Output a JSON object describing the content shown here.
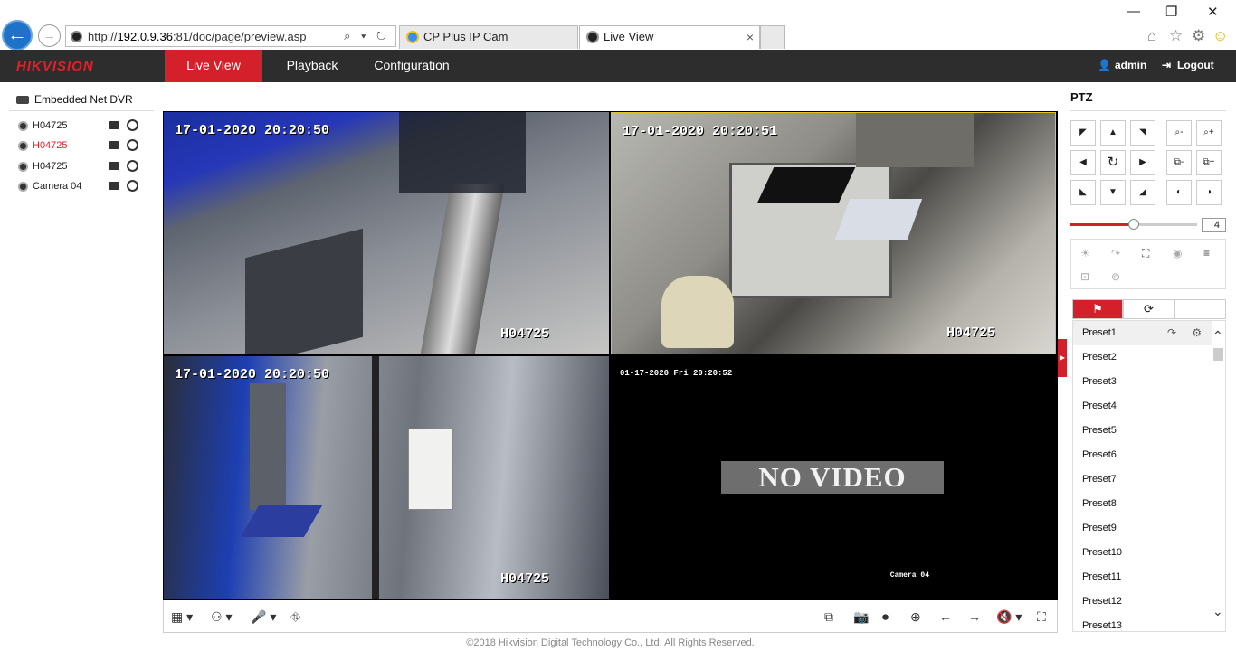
{
  "browser": {
    "url_prefix": "http://",
    "url_host": "192.0.9.36",
    "url_rest": ":81/doc/page/preview.asp",
    "url_tools": "⌕ ▾ ↻",
    "tabs": [
      {
        "label": "CP Plus IP Cam"
      },
      {
        "label": "Live View",
        "close": "×"
      }
    ],
    "win_controls": {
      "minimize": "—",
      "restore": "❐",
      "close": "✕"
    },
    "toolbar_icons": {
      "home": "⌂",
      "star": "☆",
      "gear": "⚙",
      "smiley": "☺"
    },
    "back_glyph": "←",
    "fwd_glyph": "→"
  },
  "header": {
    "logo": "HIKVISION",
    "nav": [
      {
        "label": "Live View",
        "active": true
      },
      {
        "label": "Playback",
        "active": false
      },
      {
        "label": "Configuration",
        "active": false
      }
    ],
    "user": "admin",
    "logout": "Logout",
    "user_glyph": "👤",
    "logout_glyph": "⇥"
  },
  "device_tree": {
    "root": "Embedded Net DVR",
    "channels": [
      {
        "label": "H04725",
        "color": "#111111"
      },
      {
        "label": "H04725",
        "color": "#e0202a"
      },
      {
        "label": "H04725",
        "color": "#111111"
      },
      {
        "label": "Camera 04",
        "color": "#111111"
      }
    ]
  },
  "video": {
    "panes": [
      {
        "timestamp": "17-01-2020 20:20:50",
        "name": "H04725"
      },
      {
        "timestamp": "17-01-2020 20:20:51",
        "name": "H04725"
      },
      {
        "timestamp": "17-01-2020 20:20:50",
        "name": "H04725"
      },
      {
        "timestamp": "01-17-2020 Fri 20:20:52",
        "name": "Camera 04",
        "message": "NO VIDEO"
      }
    ]
  },
  "toolbar": {
    "layout": "▦ ▾",
    "ptz": "⚇ ▾",
    "mic": "🎤 ▾",
    "record_all": "⛗",
    "right_icons": [
      "⧉",
      "📷",
      "⏺",
      "⊕",
      "←",
      "→",
      "🔇 ▾",
      "⛶"
    ]
  },
  "footer": "©2018 Hikvision Digital Technology Co., Ltd. All Rights Reserved.",
  "ptz": {
    "title": "PTZ",
    "dir_buttons": [
      "◤",
      "▲",
      "◥",
      "◀",
      "↻",
      "▶",
      "◣",
      "▼",
      "◢"
    ],
    "zoom_buttons": [
      "⌕-",
      "⌕+",
      "⧉-",
      "⧉+",
      "◐",
      "◑"
    ],
    "speed": 4,
    "speed_label": "4",
    "function_icons": [
      "☀",
      "↷",
      "⛶",
      "◉",
      "≡",
      "⊡",
      "⊚"
    ],
    "tabs": [
      {
        "label": "⚑",
        "active": true
      },
      {
        "label": "⟳",
        "active": false
      },
      {
        "label": "",
        "active": false
      }
    ],
    "presets": [
      "Preset1",
      "Preset2",
      "Preset3",
      "Preset4",
      "Preset5",
      "Preset6",
      "Preset7",
      "Preset8",
      "Preset9",
      "Preset10",
      "Preset11",
      "Preset12",
      "Preset13"
    ],
    "preset_call_glyph": "↷",
    "preset_set_glyph": "⚙",
    "scroll_up": "⌃",
    "scroll_down": "⌄",
    "collapse_glyph": "▶"
  },
  "colors": {
    "accent": "#d4202a",
    "header_bg": "#2d2d2d",
    "browser_blue": "#1e72c8"
  }
}
